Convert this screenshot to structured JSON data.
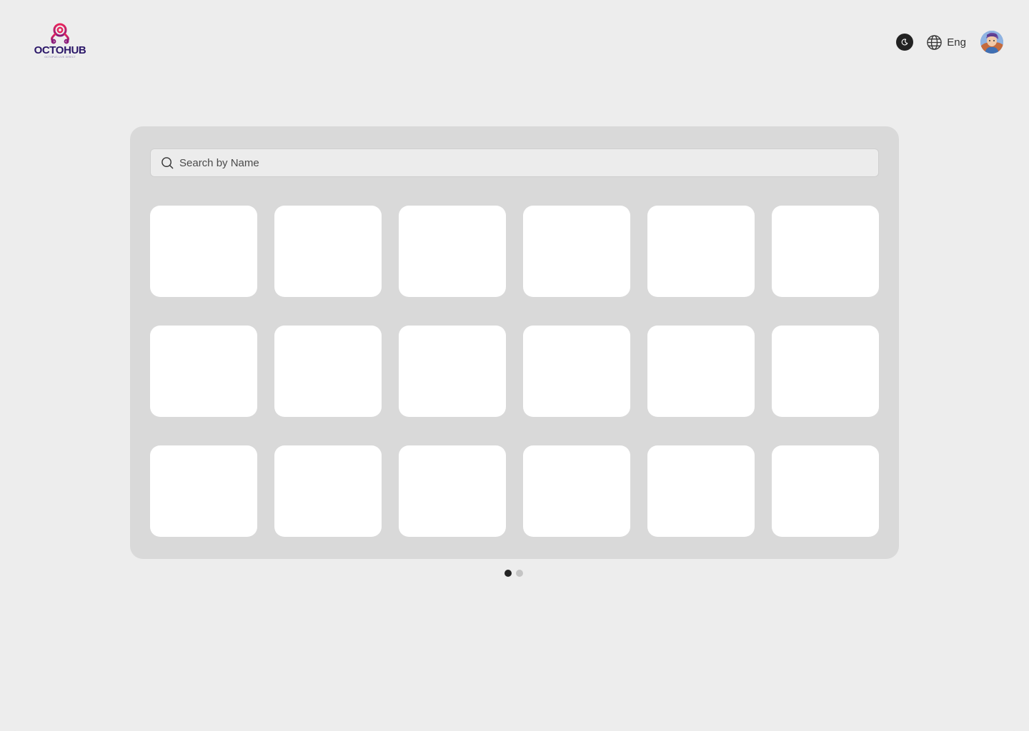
{
  "brand": {
    "name": "OCTOHUB",
    "tagline": "OCTOPUS LIVE DIRECT",
    "colors": {
      "mark": "#e0245e",
      "word": "#2a1668"
    }
  },
  "header": {
    "theme_icon": "moon-icon",
    "language": {
      "icon": "globe-icon",
      "label": "Eng"
    },
    "avatar_icon": "user-avatar"
  },
  "search": {
    "icon": "search-icon",
    "placeholder": "Search by Name",
    "value": ""
  },
  "grid": {
    "rows": 3,
    "columns": 6,
    "cards": 18
  },
  "pagination": {
    "current_page": 1,
    "total_pages": 2
  }
}
